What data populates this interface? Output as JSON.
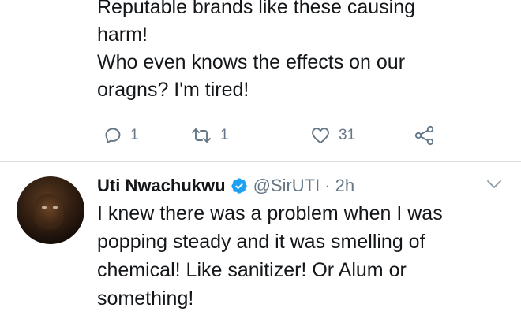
{
  "tweet_top": {
    "text_lines": [
      "Reputable brands like these causing",
      "harm!",
      "Who even knows the effects on our",
      "oragns? I'm tired!"
    ],
    "actions": {
      "reply_count": "1",
      "retweet_count": "1",
      "like_count": "31"
    }
  },
  "tweet_2": {
    "display_name": "Uti Nwachukwu",
    "handle": "@SirUTI",
    "separator": "·",
    "timestamp": "2h",
    "text_lines": [
      "I knew there was a problem when I was",
      "popping steady and it was smelling of",
      "chemical! Like sanitizer! Or Alum or",
      "something!"
    ]
  },
  "icons": {
    "reply": "reply-icon",
    "retweet": "retweet-icon",
    "like": "heart-icon",
    "share": "share-icon",
    "verified": "verified-badge-icon",
    "caret": "chevron-down-icon"
  },
  "colors": {
    "text": "#14171a",
    "muted": "#657786",
    "verified": "#1da1f2",
    "divider": "#d9dfe3"
  }
}
